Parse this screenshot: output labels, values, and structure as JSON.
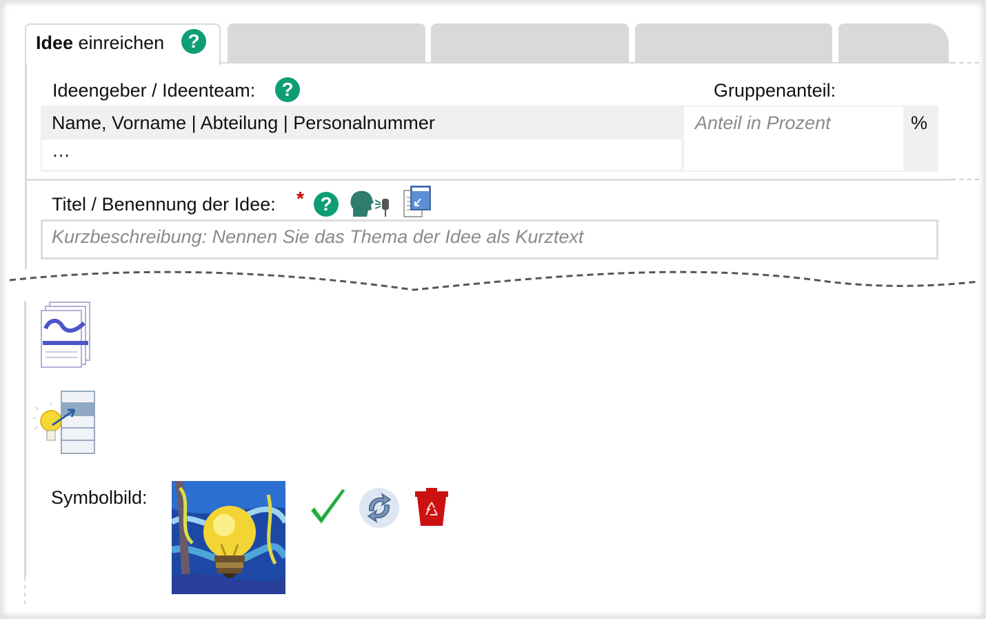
{
  "tabs": {
    "active": {
      "bold": "Idee",
      "rest": " einreichen"
    },
    "help_glyph": "?"
  },
  "ideengeber": {
    "label": "Ideengeber / Ideenteam:",
    "share_label": "Gruppenanteil:",
    "row1": "Name, Vorname | Abteilung | Personalnummer",
    "row2": "…",
    "share_placeholder": "Anteil in Prozent",
    "percent": "%"
  },
  "title_field": {
    "label": "Titel / Benennung der Idee:",
    "required_mark": "*",
    "placeholder": "Kurzbeschreibung: Nennen Sie das Thema der Idee als Kurztext"
  },
  "symbol": {
    "label": "Symbolbild:"
  },
  "icons": {
    "help": "help-icon",
    "voice": "voice-input-icon",
    "title_template": "title-template-icon",
    "similar_docs": "similar-documents-icon",
    "idea_list": "idea-list-icon",
    "accept": "checkmark-icon",
    "replace": "refresh-icon",
    "delete": "trash-icon"
  },
  "colors": {
    "help_green": "#0f9d76",
    "required_red": "#cc0000",
    "tab_grey": "#d9d9d9",
    "delete_red": "#cc1111",
    "accept_green": "#1faa3c"
  }
}
